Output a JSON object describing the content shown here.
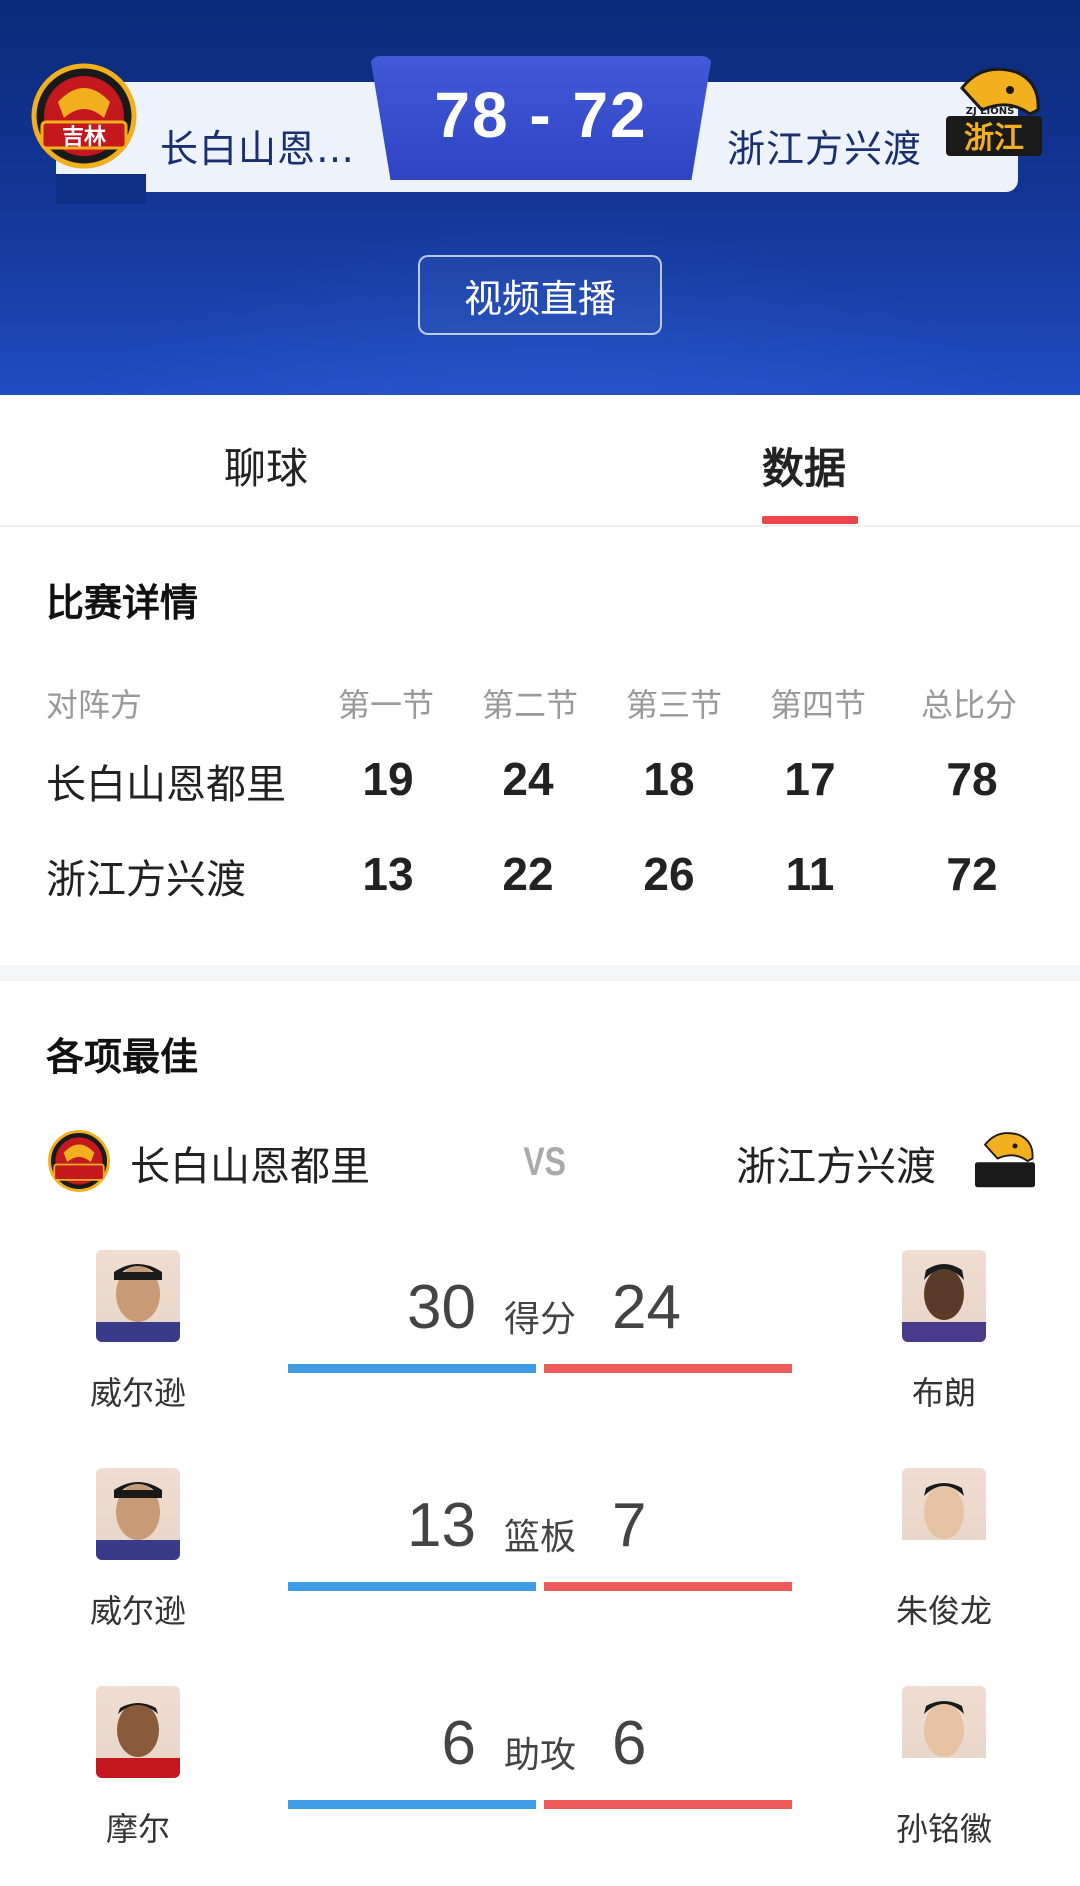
{
  "match": {
    "home_team_short": "长白山恩…",
    "away_team_short": "浙江方兴渡",
    "score": "78 - 72",
    "live_button": "视频直播",
    "home_logo_text": "吉林",
    "away_logo_text": "浙江",
    "away_logo_sub": "ZJ LIONS"
  },
  "tabs": [
    {
      "label": "聊球",
      "active": false
    },
    {
      "label": "数据",
      "active": true
    }
  ],
  "details": {
    "title": "比赛详情",
    "headers": [
      "对阵方",
      "第一节",
      "第二节",
      "第三节",
      "第四节",
      "总比分"
    ],
    "rows": [
      {
        "team": "长白山恩都里",
        "q1": "19",
        "q2": "24",
        "q3": "18",
        "q4": "17",
        "total": "78"
      },
      {
        "team": "浙江方兴渡",
        "q1": "13",
        "q2": "22",
        "q3": "26",
        "q4": "11",
        "total": "72"
      }
    ]
  },
  "best": {
    "title": "各项最佳",
    "home_team": "长白山恩都里",
    "away_team": "浙江方兴渡",
    "vs": "VS",
    "stats": [
      {
        "label": "得分",
        "home_player": "威尔逊",
        "home_value": "30",
        "away_player": "布朗",
        "away_value": "24",
        "home_share": 0.5,
        "away_share": 0.5
      },
      {
        "label": "篮板",
        "home_player": "威尔逊",
        "home_value": "13",
        "away_player": "朱俊龙",
        "away_value": "7",
        "home_share": 0.5,
        "away_share": 0.5
      },
      {
        "label": "助攻",
        "home_player": "摩尔",
        "home_value": "6",
        "away_player": "孙铭徽",
        "away_value": "6",
        "home_share": 0.5,
        "away_share": 0.5
      }
    ]
  },
  "colors": {
    "header_top": "#0b2a78",
    "score_box": "#3a4fcf",
    "tab_accent": "#e9474b",
    "home_bar": "#3f9be3",
    "away_bar": "#ee5b5b"
  }
}
